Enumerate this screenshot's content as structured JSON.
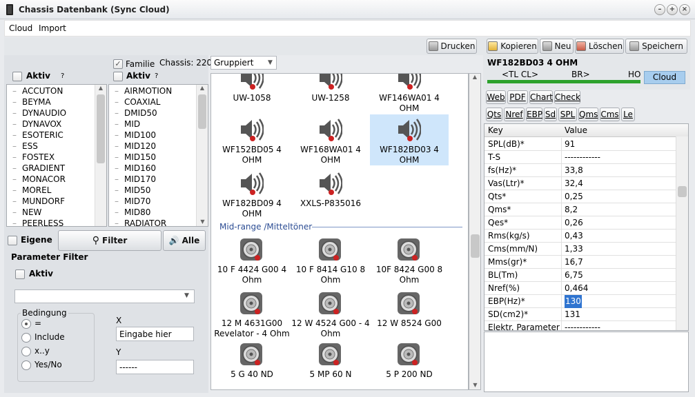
{
  "window": {
    "title": "Chassis Datenbank (Sync Cloud)"
  },
  "menu": [
    "Cloud",
    "Import"
  ],
  "toolbar": {
    "drucken": "Drucken",
    "kopieren": "Kopieren",
    "neu": "Neu",
    "loeschen": "Löschen",
    "speichern": "Speichern"
  },
  "left": {
    "aktiv1": "Aktiv",
    "q1": "?",
    "familie": "Familie",
    "familie_checked": true,
    "chassis_count": "Chassis: 220",
    "aktiv2": "Aktiv",
    "q2": "?",
    "brands": [
      "ACCUTON",
      "BEYMA",
      "DYNAUDIO",
      "DYNAVOX",
      "ESOTERIC",
      "ESS",
      "FOSTEX",
      "GRADIENT",
      "MONACOR",
      "MOREL",
      "MUNDORF",
      "NEW",
      "PEERLESS"
    ],
    "families": [
      "AIRMOTION",
      "COAXIAL",
      "DMID50",
      "MID",
      "MID100",
      "MID120",
      "MID150",
      "MID160",
      "MID170",
      "MID50",
      "MID70",
      "MID80",
      "RADIATOR"
    ],
    "eigene": "Eigene",
    "filter": "Filter",
    "alle": "Alle",
    "param_filter": "Parameter Filter",
    "aktiv3": "Aktiv",
    "bedingung": "Bedingung",
    "conditions": [
      {
        "label": "=",
        "selected": true
      },
      {
        "label": "Include",
        "selected": false
      },
      {
        "label": "x..y",
        "selected": false
      },
      {
        "label": "Yes/No",
        "selected": false
      }
    ],
    "x_label": "X",
    "x_value": "Eingabe hier",
    "y_label": "Y",
    "y_value": "------"
  },
  "center": {
    "group_select": "Gruppiert",
    "row0": [
      "UW-1058",
      "UW-1258",
      "WF146WA01 4 OHM"
    ],
    "row1": [
      "WF152BD05 4 OHM",
      "WF168WA01 4 OHM",
      "WF182BD03 4 OHM"
    ],
    "row2": [
      "WF182BD09  4 OHM",
      "XXLS-P835016"
    ],
    "section": "Mid-range /Mitteltöner",
    "row3": [
      "10 F 4424 G00  4 Ohm",
      "10 F 8414 G10  8 Ohm",
      "10F 8424 G00  8 Ohm"
    ],
    "row4": [
      "12 M 4631G00 Revelator - 4 Ohm",
      "12 W 4524 G00 - 4 Ohm",
      "12 W 8524 G00"
    ],
    "row5": [
      "5 G 40 ND",
      "5 MP 60 N",
      "5 P 200 ND"
    ]
  },
  "right": {
    "name": "WF182BD03 4 OHM",
    "tl": "<TL CL>",
    "br": "BR>",
    "ho": "HO",
    "cloud": "Cloud",
    "tabs1": [
      "Web",
      "PDF",
      "Chart",
      "Check"
    ],
    "tabs2": [
      "Qts",
      "Nref",
      "EBP",
      "Sd",
      "SPL",
      "Qms",
      "Cms",
      "Le"
    ],
    "col_key": "Key",
    "col_value": "Value",
    "rows": [
      {
        "k": "SPL(dB)*",
        "v": "91"
      },
      {
        "k": "T-S",
        "v": "------------"
      },
      {
        "k": "fs(Hz)*",
        "v": "33,8"
      },
      {
        "k": "Vas(Ltr)*",
        "v": "32,4"
      },
      {
        "k": "Qts*",
        "v": "0,25"
      },
      {
        "k": "Qms*",
        "v": "8,2"
      },
      {
        "k": "Qes*",
        "v": "0,26"
      },
      {
        "k": "Rms(kg/s)",
        "v": "0,43"
      },
      {
        "k": "Cms(mm/N)",
        "v": "1,33"
      },
      {
        "k": "Mms(gr)*",
        "v": "16,7"
      },
      {
        "k": "BL(Tm)",
        "v": "6,75"
      },
      {
        "k": "Nref(%)",
        "v": "0,464"
      },
      {
        "k": "EBP(Hz)*",
        "v": "130"
      },
      {
        "k": "SD(cm2)*",
        "v": "131"
      },
      {
        "k": "Elektr. Parameter",
        "v": "------------"
      }
    ]
  }
}
